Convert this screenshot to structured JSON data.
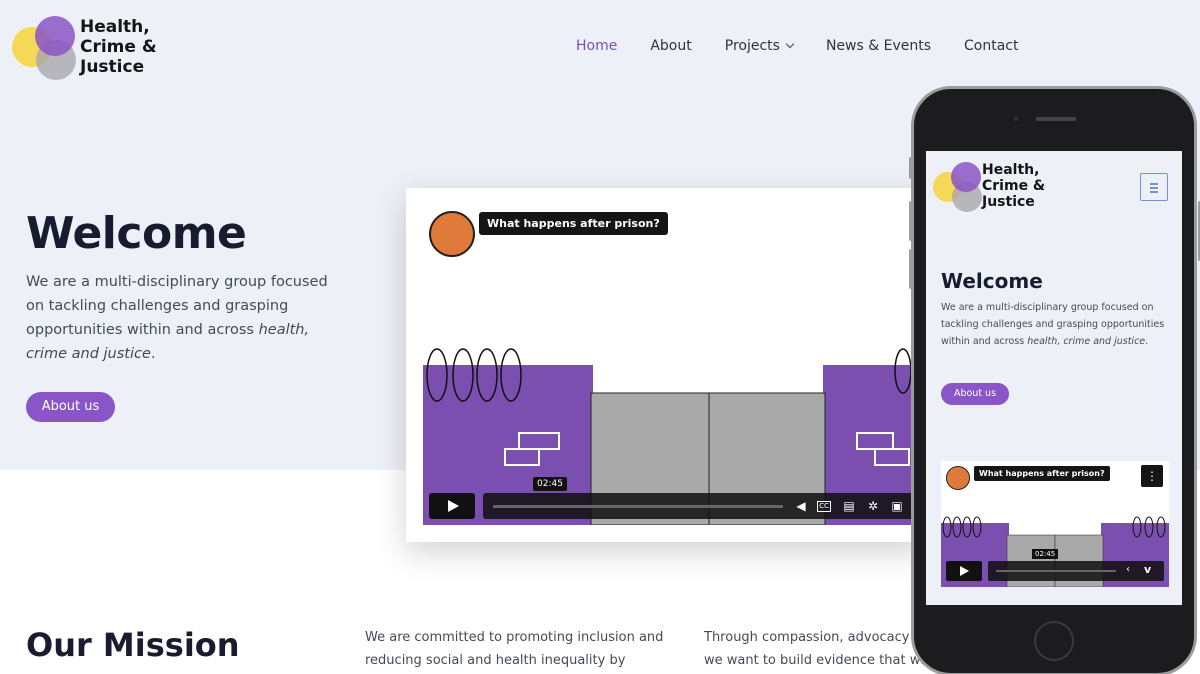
{
  "brand": {
    "name_line1": "Health,",
    "name_line2": "Crime &",
    "name_line3": "Justice"
  },
  "nav": {
    "items": [
      {
        "label": "Home",
        "active": true
      },
      {
        "label": "About"
      },
      {
        "label": "Projects"
      },
      {
        "label": "News & Events"
      },
      {
        "label": "Contact"
      }
    ]
  },
  "hero": {
    "title": "Welcome",
    "intro_plain": "We are a multi-disciplinary group focused on tackling challenges and grasping opportunities within and across ",
    "intro_em": "health, crime and justice",
    "intro_end": ".",
    "button": "About us"
  },
  "video": {
    "title": "What happens after prison?",
    "time": "02:45"
  },
  "mission": {
    "title": "Our Mission",
    "col1": "We are committed to promoting inclusion and reducing social and health inequality by",
    "col2": "Through compassion, advocacy a",
    "col2_line2": "we want to build evidence that will"
  },
  "phone": {
    "menu_icon": "hamburger-icon",
    "dots_icon": "more-vertical-icon"
  },
  "colors": {
    "accent": "#8a55c7",
    "hero_bg": "#eef0f7",
    "logo_yellow": "#f5d33a",
    "logo_purple": "#8a55c7",
    "logo_grey": "#a8a8ad",
    "wall_purple": "#7b4fb0"
  }
}
